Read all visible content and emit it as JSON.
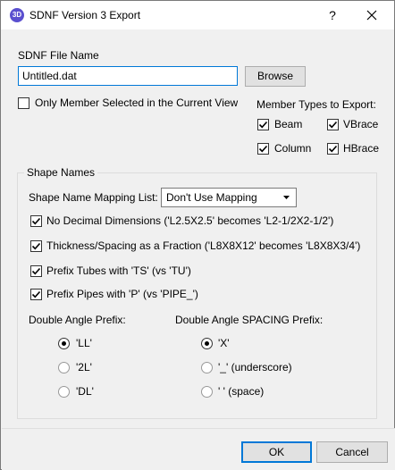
{
  "window": {
    "app_icon_text": "3D",
    "title": "SDNF Version 3 Export",
    "help_label": "?"
  },
  "file": {
    "label": "SDNF File Name",
    "value": "Untitled.dat",
    "browse_label": "Browse"
  },
  "only_selected": {
    "label": "Only Member Selected in the Current View",
    "checked": false
  },
  "member_types": {
    "label": "Member Types to Export:",
    "beam": "Beam",
    "vbrace": "VBrace",
    "column": "Column",
    "hbrace": "HBrace"
  },
  "shape_names": {
    "group_title": "Shape Names",
    "mapping_label": "Shape Name Mapping List:",
    "mapping_value": "Don't Use Mapping",
    "options": [
      {
        "label": "No Decimal Dimensions ('L2.5X2.5' becomes 'L2-1/2X2-1/2')",
        "checked": true
      },
      {
        "label": "Thickness/Spacing as a Fraction ('L8X8X12' becomes 'L8X8X3/4')",
        "checked": true
      },
      {
        "label": "Prefix Tubes with 'TS' (vs 'TU')",
        "checked": true
      },
      {
        "label": "Prefix Pipes with 'P' (vs 'PIPE_')",
        "checked": true
      }
    ]
  },
  "double_angle_prefix": {
    "label": "Double Angle Prefix:",
    "options": [
      "'LL'",
      "'2L'",
      "'DL'"
    ],
    "selected": 0
  },
  "double_angle_spacing": {
    "label": "Double Angle SPACING Prefix:",
    "options": [
      "'X'",
      "'_' (underscore)",
      "' ' (space)"
    ],
    "selected": 0
  },
  "buttons": {
    "ok": "OK",
    "cancel": "Cancel"
  }
}
